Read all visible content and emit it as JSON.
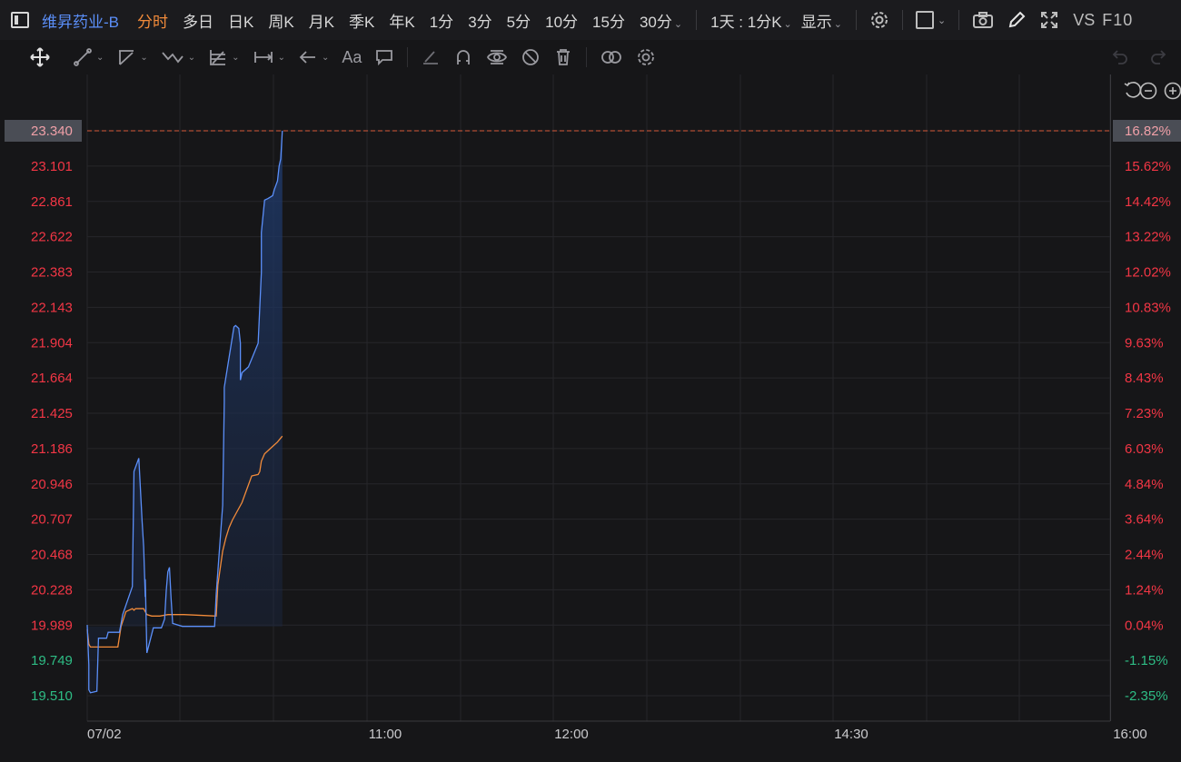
{
  "toolbar": {
    "stock_name": "维昇药业-B",
    "periods": [
      "分时",
      "多日",
      "日K",
      "周K",
      "月K",
      "季K",
      "年K",
      "1分",
      "3分",
      "5分",
      "10分",
      "15分",
      "30分"
    ],
    "active_period": "分时",
    "range_select": "1天 : 1分K",
    "display_label": "显示",
    "vs_label": "VS",
    "f10_label": "F10"
  },
  "drawing_tools": [
    "move-icon",
    "line-tool-icon",
    "channel-tool-icon",
    "wave-tool-icon",
    "fib-tool-icon",
    "measure-tool-icon",
    "arrow-tool-icon",
    "text-tool-icon",
    "comment-tool-icon",
    "pen-icon",
    "magnet-icon",
    "eye-lock-icon",
    "hide-icon",
    "trash-icon",
    "overlay-icon",
    "settings-icon"
  ],
  "colors": {
    "up": "#f23645",
    "down": "#2ebd85",
    "price_line": "#5b8ff9",
    "avg_line": "#f28b3a",
    "active_tab": "#f28b3a",
    "current_price_box": "#4a4d55"
  },
  "chart_data": {
    "type": "line",
    "left_axis_ticks": [
      "23.340",
      "23.101",
      "22.861",
      "22.622",
      "22.383",
      "22.143",
      "21.904",
      "21.664",
      "21.425",
      "21.186",
      "20.946",
      "20.707",
      "20.468",
      "20.228",
      "19.989",
      "19.749",
      "19.510"
    ],
    "right_axis_ticks": [
      "16.82%",
      "15.62%",
      "14.42%",
      "13.22%",
      "12.02%",
      "10.83%",
      "9.63%",
      "8.43%",
      "7.23%",
      "6.03%",
      "4.84%",
      "3.64%",
      "2.44%",
      "1.24%",
      "0.04%",
      "-1.15%",
      "-2.35%"
    ],
    "x_labels": [
      "07/02",
      "11:00",
      "12:00",
      "14:30",
      "16:00"
    ],
    "ylim": [
      19.51,
      23.34
    ],
    "prev_close": 19.98,
    "current_price": 23.34,
    "current_pct": "16.82%",
    "series": [
      {
        "name": "",
        "role": "price",
        "x": [
          0,
          1,
          1,
          2,
          6,
          7,
          12,
          13,
          20,
          22,
          28,
          29,
          32,
          34,
          35,
          36,
          36,
          37,
          41,
          42,
          46,
          48,
          49,
          50,
          51,
          52,
          53,
          59,
          60,
          79,
          80,
          81,
          84,
          85,
          85,
          91,
          92,
          94,
          95,
          95,
          96,
          100,
          100,
          106,
          108,
          108,
          110,
          112,
          115,
          116,
          118,
          119,
          120,
          121
        ],
        "y": [
          19.99,
          19.72,
          19.55,
          19.53,
          19.54,
          19.9,
          19.9,
          19.94,
          19.94,
          20.06,
          20.25,
          21.03,
          21.12,
          20.7,
          20.52,
          20.18,
          20.3,
          19.8,
          19.97,
          19.97,
          19.97,
          20.03,
          20.22,
          20.35,
          20.38,
          20.17,
          20.0,
          19.98,
          19.98,
          19.98,
          20.2,
          20.35,
          20.8,
          21.5,
          21.6,
          22.01,
          22.02,
          22.0,
          21.9,
          21.65,
          21.7,
          21.74,
          21.74,
          21.9,
          22.38,
          22.65,
          22.87,
          22.88,
          22.9,
          22.94,
          23.0,
          23.1,
          23.15,
          23.34
        ]
      },
      {
        "name": "",
        "role": "average",
        "x": [
          0,
          1,
          2,
          3,
          13,
          19,
          20,
          21,
          24,
          28,
          29,
          30,
          35,
          36,
          37,
          40,
          45,
          50,
          60,
          80,
          81,
          84,
          86,
          88,
          90,
          96,
          98,
          102,
          106,
          107,
          108,
          110,
          115,
          118,
          121
        ],
        "y": [
          19.96,
          19.86,
          19.84,
          19.84,
          19.84,
          19.84,
          19.91,
          19.98,
          20.08,
          20.1,
          20.09,
          20.1,
          20.1,
          20.08,
          20.06,
          20.05,
          20.05,
          20.06,
          20.06,
          20.05,
          20.26,
          20.49,
          20.58,
          20.65,
          20.7,
          20.82,
          20.88,
          21.0,
          21.01,
          21.03,
          21.1,
          21.15,
          21.2,
          21.23,
          21.27
        ]
      }
    ]
  }
}
